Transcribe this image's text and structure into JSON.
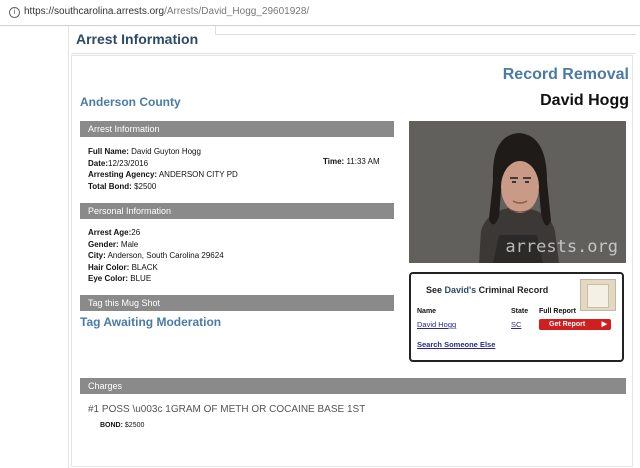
{
  "browser": {
    "url_host": "https://southcarolina.arrests.org",
    "url_path": "/Arrests/David_Hogg_29601928/"
  },
  "header": {
    "title": "Arrest Information"
  },
  "record": {
    "removal": "Record Removal",
    "name": "David Hogg",
    "county": "Anderson County"
  },
  "arrest_info": {
    "section": "Arrest Information",
    "full_name_label": "Full Name:",
    "full_name": "David Guyton Hogg",
    "date_label": "Date:",
    "date": "12/23/2016",
    "time_label": "Time:",
    "time": "11:33 AM",
    "agency_label": "Arresting Agency:",
    "agency": "ANDERSON CITY PD",
    "bond_label": "Total Bond:",
    "bond": "$2500"
  },
  "personal_info": {
    "section": "Personal Information",
    "age_label": "Arrest Age:",
    "age": "26",
    "gender_label": "Gender:",
    "gender": "Male",
    "city_label": "City:",
    "city": "Anderson, South Carolina 29624",
    "hair_label": "Hair Color:",
    "hair": "BLACK",
    "eye_label": "Eye Color:",
    "eye": "BLUE"
  },
  "tag": {
    "section": "Tag this Mug Shot",
    "status": "Tag Awaiting Moderation"
  },
  "photo": {
    "watermark": "arrests.org"
  },
  "criminal_record": {
    "title_prefix": "See ",
    "title_name": "David's",
    "title_suffix": " Criminal Record",
    "col_name": "Name",
    "col_state": "State",
    "col_report": "Full Report",
    "name": "David Hogg",
    "state": "SC",
    "get_report": "Get Report",
    "search": "Search Someone Else"
  },
  "charges": {
    "section": "Charges",
    "item": "#1 POSS \\u003c 1GRAM OF METH OR COCAINE BASE 1ST",
    "bond_label": "BOND:",
    "bond": "$2500"
  },
  "colors": {
    "accent": "#4a7aa6",
    "bar": "#8a8a8a",
    "button": "#d11e1e"
  }
}
